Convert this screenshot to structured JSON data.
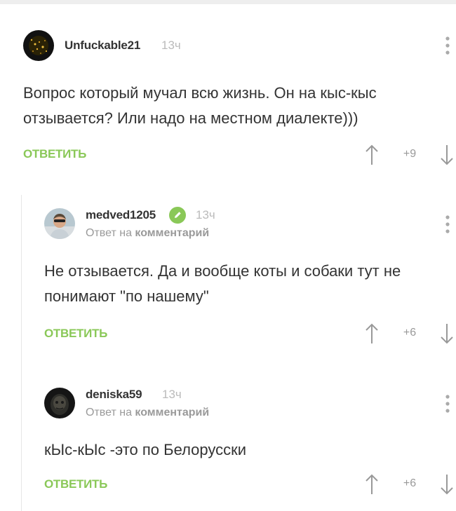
{
  "comments": [
    {
      "username": "Unfuckable21",
      "time": "13ч",
      "text": "Вопрос который мучал всю жизнь. Он на кыс-кыс отзывается? Или надо на местном диалекте)))",
      "reply_label": "ОТВЕТИТЬ",
      "rating": "+9"
    },
    {
      "username": "medved1205",
      "time": "13ч",
      "reply_to_prefix": "Ответ на ",
      "reply_to_link": "комментарий",
      "text": "Не отзывается. Да и вообще коты и собаки тут не понимают \"по нашему\"",
      "reply_label": "ОТВЕТИТЬ",
      "rating": "+6"
    },
    {
      "username": "deniska59",
      "time": "13ч",
      "reply_to_prefix": "Ответ на ",
      "reply_to_link": "комментарий",
      "text": "кЫс-кЫс -это по Белорусски",
      "reply_label": "ОТВЕТИТЬ",
      "rating": "+6"
    }
  ],
  "colors": {
    "reply_green": "#8ac858",
    "verified_green": "#8ac858",
    "muted_text": "#9a9a9a"
  }
}
